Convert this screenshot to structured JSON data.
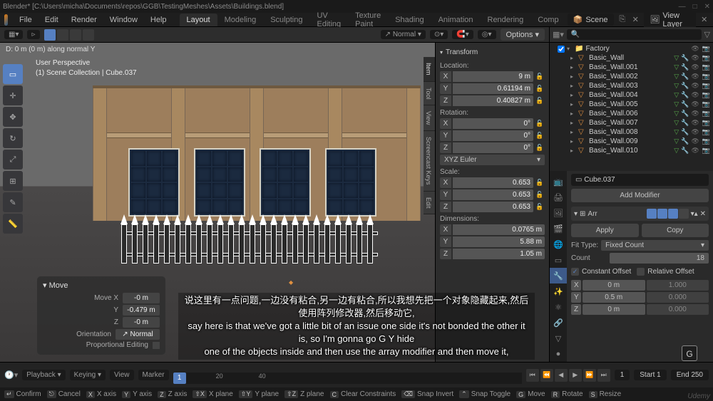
{
  "titlebar": "Blender* [C:\\Users\\micha\\Documents\\repos\\GGB\\TestingMeshes\\Assets\\Buildings.blend]",
  "menu": [
    "File",
    "Edit",
    "Render",
    "Window",
    "Help"
  ],
  "workspaces": [
    "Layout",
    "Modeling",
    "Sculpting",
    "UV Editing",
    "Texture Paint",
    "Shading",
    "Animation",
    "Rendering",
    "Comp"
  ],
  "scene_pill": "Scene",
  "viewlayer_pill": "View Layer",
  "viewport": {
    "hud": "D: 0 m (0 m) along normal Y",
    "persp": "User Perspective",
    "collection": "(1) Scene Collection | Cube.037",
    "shading_drop": "Normal",
    "options": "Options"
  },
  "n_panel": {
    "tabs": [
      "Item",
      "Tool",
      "View",
      "Screencast Keys",
      "Edit"
    ],
    "transform_head": "Transform",
    "location_label": "Location:",
    "loc": {
      "x": "9 m",
      "y": "0.61194 m",
      "z": "0.40827 m"
    },
    "rotation_label": "Rotation:",
    "rot": {
      "x": "0°",
      "y": "0°",
      "z": "0°"
    },
    "rot_mode": "XYZ Euler",
    "scale_label": "Scale:",
    "scale": {
      "x": "0.653",
      "y": "0.653",
      "z": "0.653"
    },
    "dims_label": "Dimensions:",
    "dims": {
      "x": "0.0765 m",
      "y": "5.88 m",
      "z": "1.05 m"
    }
  },
  "move_panel": {
    "title": "Move",
    "rows": {
      "Move X": "-0 m",
      "Y": "-0.479 m",
      "Z": "-0 m"
    },
    "orientation_label": "Orientation",
    "orientation": "Normal",
    "prop_edit": "Proportional Editing"
  },
  "outliner": {
    "root": "Factory",
    "items": [
      "Basic_Wall",
      "Basic_Wall.001",
      "Basic_Wall.002",
      "Basic_Wall.003",
      "Basic_Wall.004",
      "Basic_Wall.005",
      "Basic_Wall.006",
      "Basic_Wall.007",
      "Basic_Wall.008",
      "Basic_Wall.009",
      "Basic_Wall.010"
    ]
  },
  "properties": {
    "crumb": "Cube.037",
    "add_modifier": "Add Modifier",
    "mod_name": "Arr",
    "apply": "Apply",
    "copy": "Copy",
    "fit_type_label": "Fit Type:",
    "fit_type": "Fixed Count",
    "count_label": "Count",
    "count": "18",
    "constant_offset": "Constant Offset",
    "relative_offset": "Relative Offset",
    "offsets": {
      "X": [
        "0 m",
        "1.000"
      ],
      "Y": [
        "0.5 m",
        "0.000"
      ],
      "Z": [
        "0 m",
        "0.000"
      ]
    }
  },
  "timeline": {
    "playback": "Playback",
    "keying": "Keying",
    "view": "View",
    "marker": "Marker",
    "current": "1",
    "ticks": [
      "20",
      "40"
    ],
    "start_label": "Start",
    "start": "1",
    "end_label": "End",
    "end": "250"
  },
  "status": {
    "items": [
      [
        "↵",
        "Confirm"
      ],
      [
        "⎋",
        "Cancel"
      ],
      [
        "X",
        "X axis"
      ],
      [
        "Y",
        "Y axis"
      ],
      [
        "Z",
        "Z axis"
      ],
      [
        "⇧X",
        "X plane"
      ],
      [
        "⇧Y",
        "Y plane"
      ],
      [
        "⇧Z",
        "Z plane"
      ],
      [
        "C",
        "Clear Constraints"
      ],
      [
        "⌫",
        "Snap Invert"
      ],
      [
        "⌃",
        "Snap Toggle"
      ],
      [
        "G",
        "Move"
      ],
      [
        "R",
        "Rotate"
      ],
      [
        "S",
        "Resize"
      ]
    ]
  },
  "subtitle": {
    "line1": "说这里有一点问题,一边没有粘合,另一边有粘合,所以我想先把一个对象隐藏起来,然后使用阵列修改器,然后移动它,",
    "line2": "say here is that we've got a little bit of an issue one side it's not bonded the other it is, so I'm gonna go G Y hide",
    "line3": "one of the objects inside and then use the array modifier and then move it,"
  },
  "gkey": "G",
  "watermark": "Udemy"
}
